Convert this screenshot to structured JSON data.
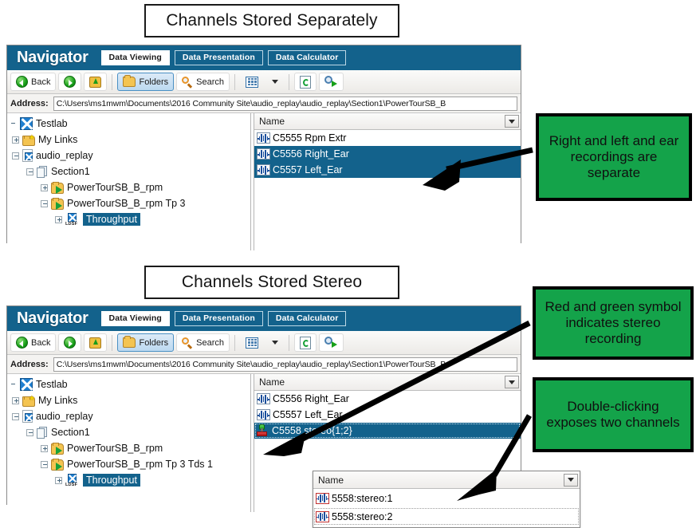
{
  "sections": [
    {
      "title": "Channels Stored Separately",
      "navigator": {
        "brand": "Navigator",
        "tabs": [
          {
            "label": "Data Viewing",
            "active": true
          },
          {
            "label": "Data Presentation",
            "active": false
          },
          {
            "label": "Data Calculator",
            "active": false
          }
        ],
        "toolbar": {
          "back_label": "Back",
          "forward_label": "",
          "up_label": "",
          "folders_label": "Folders",
          "search_label": "Search",
          "views_label": "",
          "refresh_label": "",
          "find_label": ""
        },
        "address": {
          "label": "Address:",
          "value": "C:\\Users\\ms1mwm\\Documents\\2016 Community Site\\audio_replay\\audio_replay\\Section1\\PowerTourSB_B"
        },
        "tree": [
          {
            "label": "Testlab",
            "icon": "testlab-icon",
            "indent": 0,
            "expander": "none",
            "selected": false
          },
          {
            "label": "My Links",
            "icon": "my-links-folder-icon",
            "indent": 1,
            "expander": "plus",
            "selected": false
          },
          {
            "label": "audio_replay",
            "icon": "project-document-icon",
            "indent": 1,
            "expander": "minus",
            "selected": false
          },
          {
            "label": "Section1",
            "icon": "section-pages-icon",
            "indent": 2,
            "expander": "minus",
            "selected": false
          },
          {
            "label": "PowerTourSB_B_rpm",
            "icon": "run-folder-icon",
            "indent": 3,
            "expander": "plus",
            "selected": false
          },
          {
            "label": "PowerTourSB_B_rpm Tp 3",
            "icon": "run-folder-icon",
            "indent": 3,
            "expander": "minus",
            "selected": false
          },
          {
            "label": "Throughput",
            "icon": "ldsf-icon",
            "indent": 4,
            "expander": "plus",
            "selected": true
          }
        ],
        "list": {
          "column_header": "Name",
          "rows": [
            {
              "label": "C5555 Rpm Extr",
              "icon": "waveform-icon",
              "selected": false
            },
            {
              "label": "C5556 Right_Ear",
              "icon": "waveform-icon",
              "selected": true
            },
            {
              "label": "C5557 Left_Ear",
              "icon": "waveform-icon",
              "selected": true
            }
          ]
        }
      },
      "callouts": [
        {
          "text": "Right and left and ear recordings are separate"
        }
      ]
    },
    {
      "title": "Channels Stored Stereo",
      "navigator": {
        "brand": "Navigator",
        "tabs": [
          {
            "label": "Data Viewing",
            "active": true
          },
          {
            "label": "Data Presentation",
            "active": false
          },
          {
            "label": "Data Calculator",
            "active": false
          }
        ],
        "toolbar": {
          "back_label": "Back",
          "forward_label": "",
          "up_label": "",
          "folders_label": "Folders",
          "search_label": "Search",
          "views_label": "",
          "refresh_label": "",
          "find_label": ""
        },
        "address": {
          "label": "Address:",
          "value": "C:\\Users\\ms1mwm\\Documents\\2016 Community Site\\audio_replay\\audio_replay\\Section1\\PowerTourSB_B"
        },
        "tree": [
          {
            "label": "Testlab",
            "icon": "testlab-icon",
            "indent": 0,
            "expander": "none",
            "selected": false
          },
          {
            "label": "My Links",
            "icon": "my-links-folder-icon",
            "indent": 1,
            "expander": "plus",
            "selected": false
          },
          {
            "label": "audio_replay",
            "icon": "project-document-icon",
            "indent": 1,
            "expander": "minus",
            "selected": false
          },
          {
            "label": "Section1",
            "icon": "section-pages-icon",
            "indent": 2,
            "expander": "minus",
            "selected": false
          },
          {
            "label": "PowerTourSB_B_rpm",
            "icon": "run-folder-icon",
            "indent": 3,
            "expander": "plus",
            "selected": false
          },
          {
            "label": "PowerTourSB_B_rpm Tp 3 Tds 1",
            "icon": "run-folder-icon",
            "indent": 3,
            "expander": "minus",
            "selected": false
          },
          {
            "label": "Throughput",
            "icon": "ldsf-icon",
            "indent": 4,
            "expander": "plus",
            "selected": true
          }
        ],
        "list": {
          "column_header": "Name",
          "rows": [
            {
              "label": "C5556 Right_Ear",
              "icon": "waveform-icon",
              "selected": false
            },
            {
              "label": "C5557 Left_Ear",
              "icon": "waveform-icon",
              "selected": false
            },
            {
              "label": "C5558 stereo{1;2}",
              "icon": "stereo-red-green-icon",
              "selected": true
            }
          ]
        }
      },
      "popup": {
        "column_header": "Name",
        "rows": [
          {
            "label": "5558:stereo:1",
            "icon": "waveform-red-icon"
          },
          {
            "label": "5558:stereo:2",
            "icon": "waveform-red-icon"
          }
        ]
      },
      "callouts": [
        {
          "text": "Red and green symbol indicates stereo recording"
        },
        {
          "text": "Double-clicking exposes two channels"
        }
      ]
    }
  ],
  "colors": {
    "header_blue": "#13628c",
    "selection_blue": "#13628c",
    "callout_green": "#14a34a",
    "callout_border": "#000000"
  }
}
